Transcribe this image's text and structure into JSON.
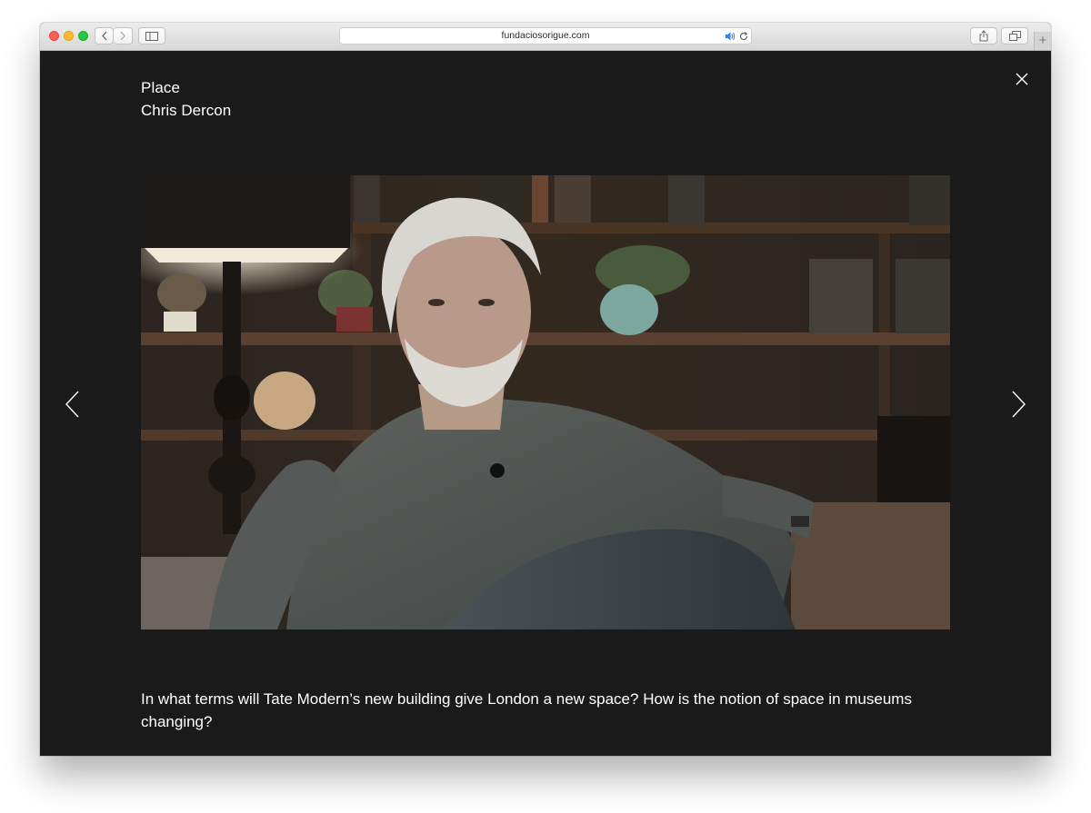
{
  "browser": {
    "url": "fundaciosorigue.com",
    "new_tab_label": "+"
  },
  "page": {
    "section_label": "Place",
    "person_name": "Chris Dercon",
    "question": "In what terms will Tate Modern’s new building give London a new space? How is the notion of space in museums changing?"
  },
  "icons": {
    "close": "close-icon",
    "prev": "chevron-left-icon",
    "next": "chevron-right-icon",
    "audio": "speaker-icon",
    "reload": "reload-icon",
    "share": "share-icon",
    "tabs": "tabs-overview-icon",
    "sidebar": "sidebar-icon"
  },
  "colors": {
    "background": "#1a1a1a",
    "text": "#ffffff",
    "audio_accent": "#2f7df6"
  }
}
